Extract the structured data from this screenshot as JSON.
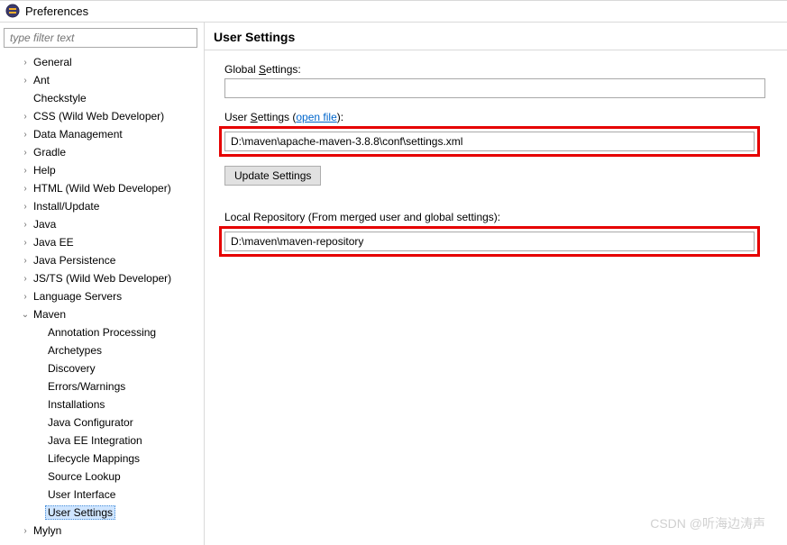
{
  "window": {
    "title": "Preferences"
  },
  "sidebar": {
    "filter_placeholder": "type filter text",
    "items": [
      {
        "label": "General",
        "icon": "chev",
        "indent": 1
      },
      {
        "label": "Ant",
        "icon": "chev",
        "indent": 1
      },
      {
        "label": "Checkstyle",
        "icon": "none",
        "indent": 1
      },
      {
        "label": "CSS (Wild Web Developer)",
        "icon": "chev",
        "indent": 1
      },
      {
        "label": "Data Management",
        "icon": "chev",
        "indent": 1
      },
      {
        "label": "Gradle",
        "icon": "chev",
        "indent": 1
      },
      {
        "label": "Help",
        "icon": "chev",
        "indent": 1
      },
      {
        "label": "HTML (Wild Web Developer)",
        "icon": "chev",
        "indent": 1
      },
      {
        "label": "Install/Update",
        "icon": "chev",
        "indent": 1
      },
      {
        "label": "Java",
        "icon": "chev",
        "indent": 1
      },
      {
        "label": "Java EE",
        "icon": "chev",
        "indent": 1
      },
      {
        "label": "Java Persistence",
        "icon": "chev",
        "indent": 1
      },
      {
        "label": "JS/TS (Wild Web Developer)",
        "icon": "chev",
        "indent": 1
      },
      {
        "label": "Language Servers",
        "icon": "chev",
        "indent": 1
      },
      {
        "label": "Maven",
        "icon": "down",
        "indent": 1
      },
      {
        "label": "Annotation Processing",
        "icon": "none",
        "indent": 2
      },
      {
        "label": "Archetypes",
        "icon": "none",
        "indent": 2
      },
      {
        "label": "Discovery",
        "icon": "none",
        "indent": 2
      },
      {
        "label": "Errors/Warnings",
        "icon": "none",
        "indent": 2
      },
      {
        "label": "Installations",
        "icon": "none",
        "indent": 2
      },
      {
        "label": "Java Configurator",
        "icon": "none",
        "indent": 2
      },
      {
        "label": "Java EE Integration",
        "icon": "none",
        "indent": 2
      },
      {
        "label": "Lifecycle Mappings",
        "icon": "none",
        "indent": 2
      },
      {
        "label": "Source Lookup",
        "icon": "none",
        "indent": 2
      },
      {
        "label": "User Interface",
        "icon": "none",
        "indent": 2
      },
      {
        "label": "User Settings",
        "icon": "none",
        "indent": 2,
        "selected": true
      },
      {
        "label": "Mylyn",
        "icon": "chev",
        "indent": 1
      }
    ]
  },
  "main": {
    "heading": "User Settings",
    "global_label_pre": "Global ",
    "global_label_u": "S",
    "global_label_post": "ettings:",
    "global_value": "",
    "user_label_pre": "User ",
    "user_label_u": "S",
    "user_label_post": "ettings (",
    "user_link": "open file",
    "user_label_end": "):",
    "user_value": "D:\\maven\\apache-maven-3.8.8\\conf\\settings.xml",
    "update_btn": "Update Settings",
    "local_repo_label": "Local Repository (From merged user and global settings):",
    "local_repo_value": "D:\\maven\\maven-repository"
  },
  "watermark": "CSDN @听海边涛声"
}
